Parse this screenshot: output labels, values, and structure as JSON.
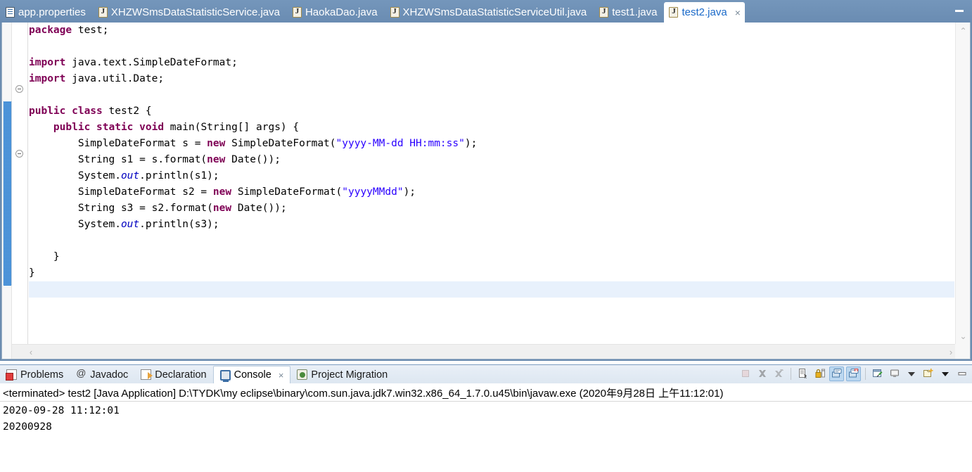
{
  "editor": {
    "tabs": [
      {
        "label": "app.properties",
        "icon": "properties-file-icon",
        "active": false,
        "closable": false
      },
      {
        "label": "XHZWSmsDataStatisticService.java",
        "icon": "java-file-icon",
        "active": false,
        "closable": false
      },
      {
        "label": "HaokaDao.java",
        "icon": "java-file-icon",
        "active": false,
        "closable": false
      },
      {
        "label": "XHZWSmsDataStatisticServiceUtil.java",
        "icon": "java-file-icon",
        "active": false,
        "closable": false
      },
      {
        "label": "test1.java",
        "icon": "java-file-icon",
        "active": false,
        "closable": false
      },
      {
        "label": "test2.java",
        "icon": "java-file-icon",
        "active": true,
        "closable": true
      }
    ],
    "close_glyph": "×",
    "minimize_label": "",
    "code_lines": [
      {
        "indent": 0,
        "html": "<span class='k'>package</span> test;",
        "highlight": false
      },
      {
        "indent": 0,
        "html": "",
        "highlight": false
      },
      {
        "indent": 0,
        "html": "<span class='k'>import</span> java.text.SimpleDateFormat;",
        "highlight": false
      },
      {
        "indent": 0,
        "html": "<span class='k'>import</span> java.util.Date;",
        "highlight": false
      },
      {
        "indent": 0,
        "html": "",
        "highlight": false
      },
      {
        "indent": 0,
        "html": "<span class='k'>public class</span> test2 {",
        "highlight": false
      },
      {
        "indent": 0,
        "html": "    <span class='k'>public static void</span> main(String[] args) {",
        "highlight": false
      },
      {
        "indent": 0,
        "html": "        SimpleDateFormat s = <span class='k'>new</span> SimpleDateFormat(<span class='s'>\"yyyy-MM-dd HH:mm:ss\"</span>);",
        "highlight": false
      },
      {
        "indent": 0,
        "html": "        String s1 = s.format(<span class='k'>new</span> Date());",
        "highlight": false
      },
      {
        "indent": 0,
        "html": "        System.<span class='f'>out</span>.println(s1);",
        "highlight": false
      },
      {
        "indent": 0,
        "html": "        SimpleDateFormat s2 = <span class='k'>new</span> SimpleDateFormat(<span class='s'>\"yyyyMMdd\"</span>);",
        "highlight": false
      },
      {
        "indent": 0,
        "html": "        String s3 = s2.format(<span class='k'>new</span> Date());",
        "highlight": false
      },
      {
        "indent": 0,
        "html": "        System.<span class='f'>out</span>.println(s3);",
        "highlight": false
      },
      {
        "indent": 0,
        "html": "",
        "highlight": false
      },
      {
        "indent": 0,
        "html": "    }",
        "highlight": false
      },
      {
        "indent": 0,
        "html": "}",
        "highlight": false
      },
      {
        "indent": 0,
        "html": "",
        "highlight": true
      },
      {
        "indent": 0,
        "html": "",
        "highlight": false
      }
    ],
    "plain_code": "package test;\n\nimport java.text.SimpleDateFormat;\nimport java.util.Date;\n\npublic class test2 {\n    public static void main(String[] args) {\n        SimpleDateFormat s = new SimpleDateFormat(\"yyyy-MM-dd HH:mm:ss\");\n        String s1 = s.format(new Date());\n        System.out.println(s1);\n        SimpleDateFormat s2 = new SimpleDateFormat(\"yyyyMMdd\");\n        String s3 = s2.format(new Date());\n        System.out.println(s3);\n\n    }\n}\n",
    "scroll": {
      "up_arrow": "⌃",
      "down_arrow": "⌄",
      "left_arrow": "‹",
      "right_arrow": "›"
    }
  },
  "console_panel": {
    "tabs": [
      {
        "label": "Problems",
        "icon": "problems-icon",
        "active": false,
        "closable": false
      },
      {
        "label": "Javadoc",
        "icon": "javadoc-icon",
        "active": false,
        "closable": false
      },
      {
        "label": "Declaration",
        "icon": "declaration-icon",
        "active": false,
        "closable": false
      },
      {
        "label": "Console",
        "icon": "console-icon",
        "active": true,
        "closable": true
      },
      {
        "label": "Project Migration",
        "icon": "project-migration-icon",
        "active": false,
        "closable": false
      }
    ],
    "close_glyph": "×",
    "toolbar": [
      {
        "name": "terminate-button",
        "enabled": false,
        "toggled": false
      },
      {
        "name": "remove-launch-button",
        "enabled": false,
        "toggled": false
      },
      {
        "name": "remove-all-terminated-button",
        "enabled": false,
        "toggled": false
      },
      {
        "name": "separator-1",
        "enabled": false,
        "toggled": false
      },
      {
        "name": "clear-console-button",
        "enabled": true,
        "toggled": false
      },
      {
        "name": "scroll-lock-button",
        "enabled": true,
        "toggled": false
      },
      {
        "name": "show-console-on-output-button",
        "enabled": true,
        "toggled": true
      },
      {
        "name": "show-console-on-error-button",
        "enabled": true,
        "toggled": true
      },
      {
        "name": "separator-2",
        "enabled": false,
        "toggled": false
      },
      {
        "name": "pin-console-button",
        "enabled": true,
        "toggled": false
      },
      {
        "name": "display-selected-console-button",
        "enabled": true,
        "toggled": false
      },
      {
        "name": "display-selected-console-dropdown",
        "enabled": true,
        "toggled": false
      },
      {
        "name": "open-console-button",
        "enabled": true,
        "toggled": false
      },
      {
        "name": "open-console-dropdown",
        "enabled": true,
        "toggled": false
      },
      {
        "name": "minimize-button",
        "enabled": true,
        "toggled": false
      }
    ],
    "header_line": "<terminated> test2 [Java Application] D:\\TYDK\\my eclipse\\binary\\com.sun.java.jdk7.win32.x86_64_1.7.0.u45\\bin\\javaw.exe (2020年9月28日 上午11:12:01)",
    "output_lines": [
      "2020-09-28 11:12:01",
      "20200928"
    ]
  },
  "colors": {
    "tab_bar_blue": "#6b8cb0",
    "active_tab_text": "#1b6ac9",
    "keyword": "#7f0055",
    "string": "#2a00ff",
    "static_field": "#0000c0",
    "current_line_highlight": "#e8f1fc",
    "change_bar": "#1874cd"
  }
}
